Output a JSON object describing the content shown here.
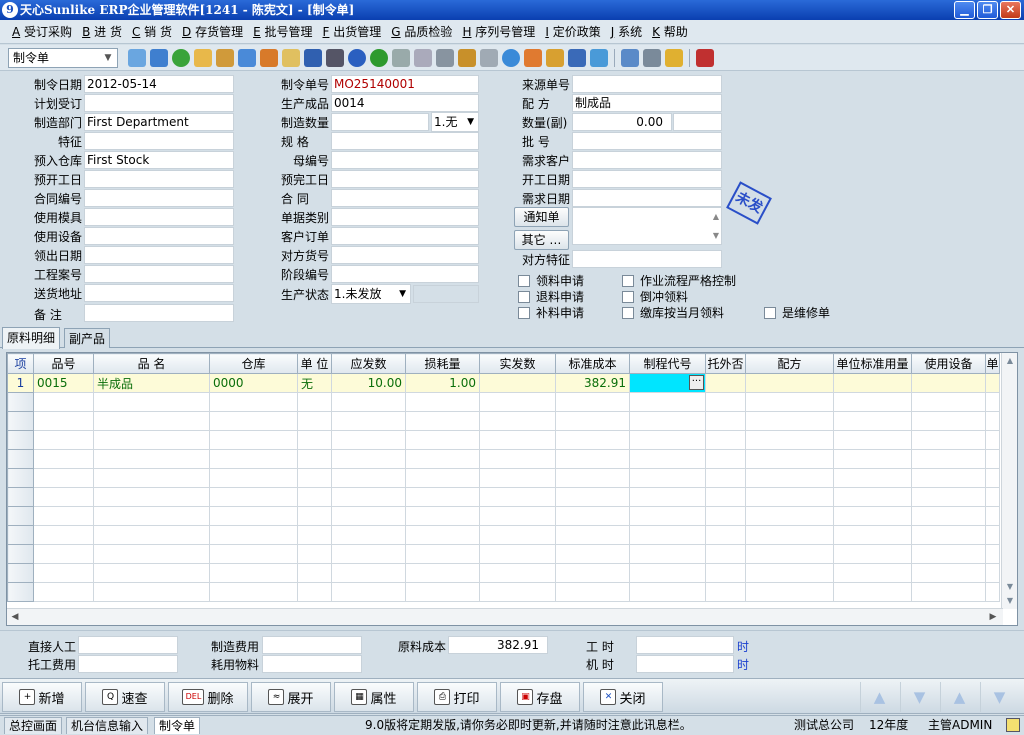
{
  "title": "天心Sunlike ERP企业管理软件[1241 - 陈宪文] - [制令单]",
  "menu": [
    {
      "key": "A",
      "label": "受订采购"
    },
    {
      "key": "B",
      "label": "进  货"
    },
    {
      "key": "C",
      "label": "销  货"
    },
    {
      "key": "D",
      "label": "存货管理"
    },
    {
      "key": "E",
      "label": "批号管理"
    },
    {
      "key": "F",
      "label": "出货管理"
    },
    {
      "key": "G",
      "label": "品质检验"
    },
    {
      "key": "H",
      "label": "序列号管理"
    },
    {
      "key": "I",
      "label": "定价政策"
    },
    {
      "key": "J",
      "label": "系统"
    },
    {
      "key": "K",
      "label": "帮助"
    }
  ],
  "toolbar": {
    "form_select": "制令单"
  },
  "form": {
    "labels": {
      "order_date": "制令日期",
      "plan_order": "计划受订",
      "dept": "制造部门",
      "feature": "特征",
      "warehouse": "预入仓库",
      "start_date": "预开工日",
      "contract": "合同编号",
      "mold": "使用模具",
      "equipment": "使用设备",
      "issue_date": "领出日期",
      "project": "工程案号",
      "address": "送货地址",
      "remark": "备    注",
      "order_no": "制令单号",
      "product": "生产成品",
      "qty": "制造数量",
      "spec": "规    格",
      "parent_no": "母编号",
      "finish_date": "预完工日",
      "contract2": "合    同",
      "doc_type": "单据类别",
      "cust_order": "客户订单",
      "partner_no": "对方货号",
      "stage_no": "阶段编号",
      "status": "生产状态",
      "source_no": "来源单号",
      "formula": "配    方",
      "qty_sub": "数量(副)",
      "batch": "批    号",
      "req_cust": "需求客户",
      "work_start": "开工日期",
      "req_date": "需求日期",
      "partner_feature": "对方特征"
    },
    "values": {
      "order_date": "2012-05-14",
      "dept": "First Department",
      "warehouse": "First Stock",
      "order_no": "MO25140001",
      "product": "0014",
      "qty_unit": "1.无",
      "formula": "制成品",
      "qty_sub": "0.00",
      "status": "1.未发放"
    },
    "buttons": {
      "notice": "通知单",
      "other": "其它 …"
    },
    "checks": [
      "领料申请",
      "退料申请",
      "补料申请",
      "作业流程严格控制",
      "倒冲领料",
      "缴库按当月领料",
      "是维修单"
    ],
    "stamp": "未发"
  },
  "tabs": [
    "原料明细",
    "副产品"
  ],
  "grid": {
    "columns": [
      "项",
      "品号",
      "品  名",
      "仓库",
      "单 位",
      "应发数",
      "损耗量",
      "实发数",
      "标准成本",
      "制程代号",
      "托外否",
      "配方",
      "单位标准用量",
      "使用设备",
      "单"
    ],
    "rows": [
      [
        "1",
        "0015",
        "半成品",
        "0000",
        "无",
        "10.00",
        "1.00",
        "",
        "382.91",
        "",
        "",
        "",
        "",
        "",
        ""
      ]
    ],
    "empty_rows": 11
  },
  "summary": {
    "labor": "直接人工",
    "outsource": "托工费用",
    "mfg_cost": "制造费用",
    "material_cost_lbl": "耗用物料",
    "raw_cost_lbl": "原料成本",
    "raw_cost": "382.91",
    "work_time": "工    时",
    "machine_time": "机    时",
    "unit": "时"
  },
  "actions": [
    {
      "label": "新增",
      "icon": "+"
    },
    {
      "label": "速查",
      "icon": "Q"
    },
    {
      "label": "删除",
      "icon": "DEL"
    },
    {
      "label": "展开",
      "icon": "≈"
    },
    {
      "label": "属性",
      "icon": "▦"
    },
    {
      "label": "打印",
      "icon": "⎙"
    },
    {
      "label": "存盘",
      "icon": "▣"
    },
    {
      "label": "关闭",
      "icon": "✕"
    }
  ],
  "status": {
    "tab1": "总控画面",
    "tab2": "机台信息输入",
    "tab3": "制令单",
    "message": "9.0版将定期发版,请你务必即时更新,并请随时注意此讯息栏。",
    "company": "测试总公司",
    "year": "12年度",
    "user": "主管ADMIN"
  }
}
